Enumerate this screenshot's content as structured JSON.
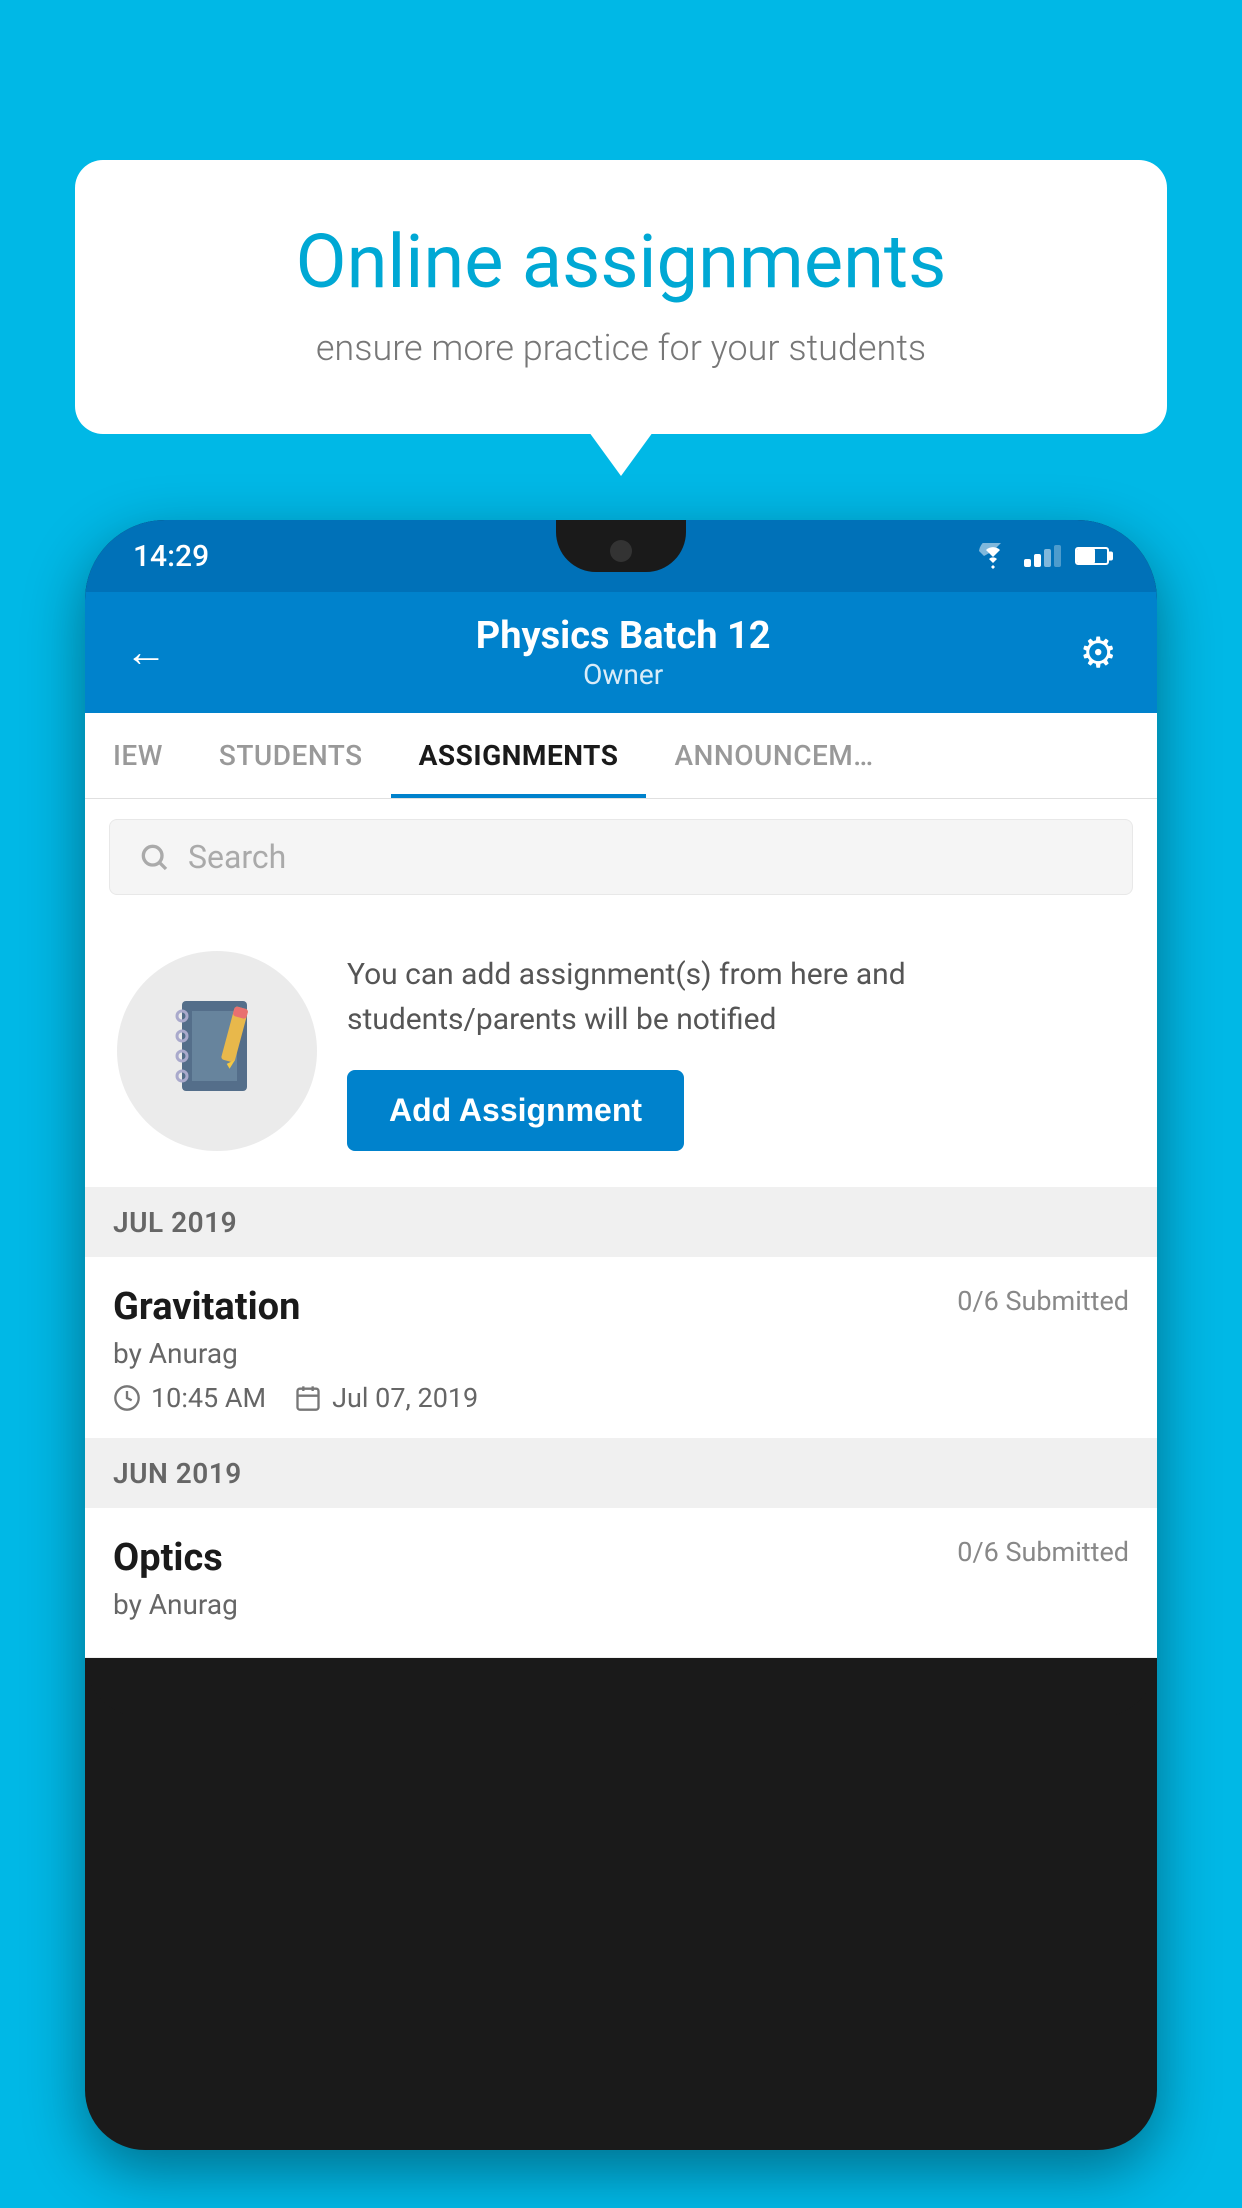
{
  "background_color": "#00b8e6",
  "speech_bubble": {
    "title": "Online assignments",
    "subtitle": "ensure more practice for your students"
  },
  "phone": {
    "status_bar": {
      "time": "14:29"
    },
    "header": {
      "title": "Physics Batch 12",
      "subtitle": "Owner",
      "back_label": "←",
      "settings_label": "⚙"
    },
    "tabs": [
      {
        "label": "IEW",
        "active": false
      },
      {
        "label": "STUDENTS",
        "active": false
      },
      {
        "label": "ASSIGNMENTS",
        "active": true
      },
      {
        "label": "ANNOUNCEM…",
        "active": false
      }
    ],
    "search": {
      "placeholder": "Search"
    },
    "promo": {
      "description": "You can add assignment(s) from here and students/parents will be notified",
      "button_label": "Add Assignment"
    },
    "sections": [
      {
        "header": "JUL 2019",
        "assignments": [
          {
            "name": "Gravitation",
            "submitted": "0/6 Submitted",
            "author": "by Anurag",
            "time": "10:45 AM",
            "date": "Jul 07, 2019"
          }
        ]
      },
      {
        "header": "JUN 2019",
        "assignments": [
          {
            "name": "Optics",
            "submitted": "0/6 Submitted",
            "author": "by Anurag",
            "time": "",
            "date": ""
          }
        ]
      }
    ]
  }
}
